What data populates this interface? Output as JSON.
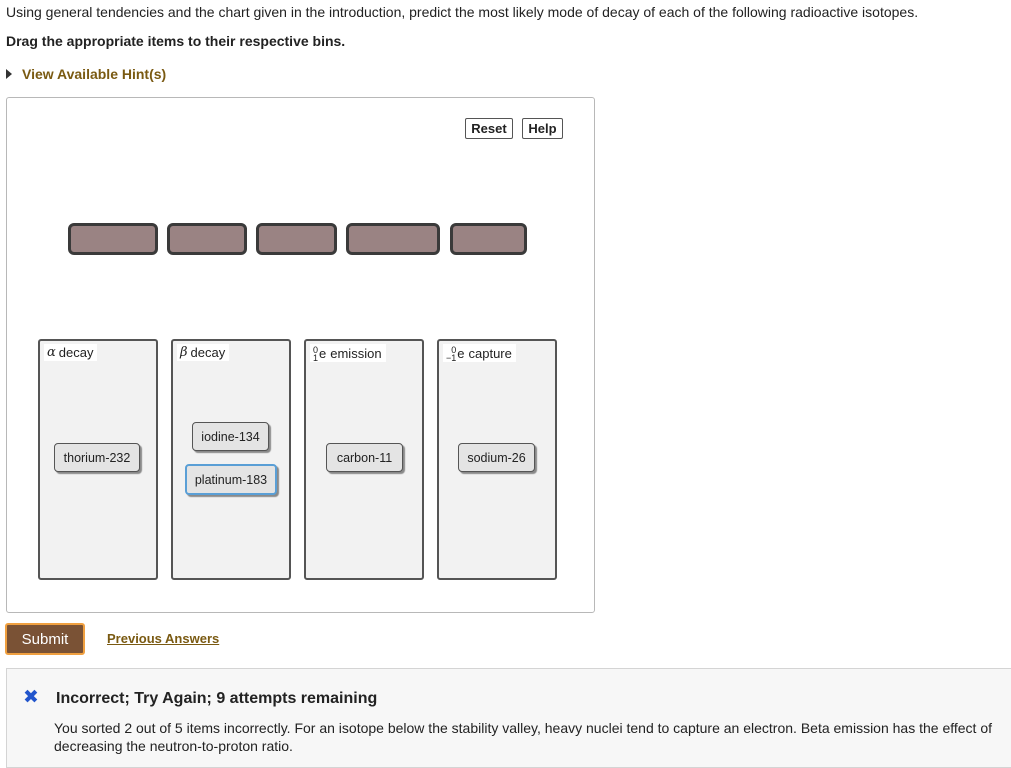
{
  "question": "Using general tendencies and the chart given in the introduction, predict the most likely mode of decay of each of the following radioactive isotopes.",
  "instruction": "Drag the appropriate items to their respective bins.",
  "hint_label": "View Available Hint(s)",
  "toolbar": {
    "reset": "Reset",
    "help": "Help"
  },
  "bins": [
    {
      "symbol": "α",
      "label": "decay",
      "items": [
        "thorium-232"
      ]
    },
    {
      "symbol": "β",
      "label": "decay",
      "items": [
        "iodine-134",
        "platinum-183"
      ]
    },
    {
      "mass": "0",
      "charge": "1",
      "particle": "e",
      "label": "emission",
      "items": [
        "carbon-11"
      ]
    },
    {
      "mass": "0",
      "charge": "−1",
      "particle": "e",
      "label": "capture",
      "items": [
        "sodium-26"
      ]
    }
  ],
  "submit_label": "Submit",
  "previous_answers_label": "Previous Answers",
  "feedback": {
    "icon": "close-x-icon",
    "title": "Incorrect; Try Again; 9 attempts remaining",
    "message": "You sorted 2 out of 5 items incorrectly. For an isotope below the stability valley,  heavy nuclei tend to capture an electron. Beta emission has the effect of decreasing the neutron-to-proton ratio."
  },
  "colors": {
    "accent": "#7a5235",
    "submit_border": "#f0a040",
    "link": "#7a5a12",
    "slot_fill": "#9a8383",
    "feedback_icon": "#2255cc"
  }
}
